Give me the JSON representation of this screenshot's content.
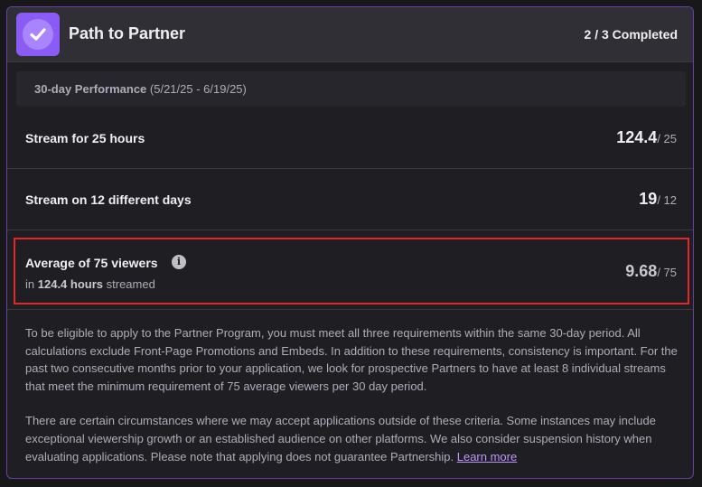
{
  "header": {
    "title": "Path to Partner",
    "status": "2 / 3 Completed",
    "badge_icon": "checkmark-badge-icon",
    "accent": "#8a5cf5"
  },
  "period": {
    "label": "30-day Performance",
    "range": "(5/21/25 - 6/19/25)"
  },
  "requirements": [
    {
      "label": "Stream for 25 hours",
      "value": "124.4",
      "target": "/ 25"
    },
    {
      "label": "Stream on 12 different days",
      "value": "19",
      "target": "/ 12"
    },
    {
      "label": "Average of 75 viewers",
      "value": "9.68",
      "target": "/ 75",
      "sub_prefix": "in",
      "sub_hours": "124.4 hours",
      "sub_suffix": "streamed",
      "info_icon": "info-icon"
    }
  ],
  "description": {
    "paragraph1": "To be eligible to apply to the Partner Program, you must meet all three requirements within the same 30-day period. All calculations exclude Front-Page Promotions and Embeds. In addition to these requirements, consistency is important. For the past two consecutive months prior to your application, we look for prospective Partners to have at least 8 individual streams that meet the minimum requirement of 75 average viewers per 30 day period.",
    "paragraph2": "There are certain circumstances where we may accept applications outside of these criteria. Some instances may include exceptional viewership growth or an established audience on other platforms. We also consider suspension history when evaluating applications. Please note that applying does not guarantee Partnership.",
    "link": "Learn more"
  },
  "colors": {
    "background": "#1f1f23",
    "header": "#2f2f35",
    "border": "#6441a5",
    "highlight": "#e4262b",
    "link": "#bf94ff"
  }
}
